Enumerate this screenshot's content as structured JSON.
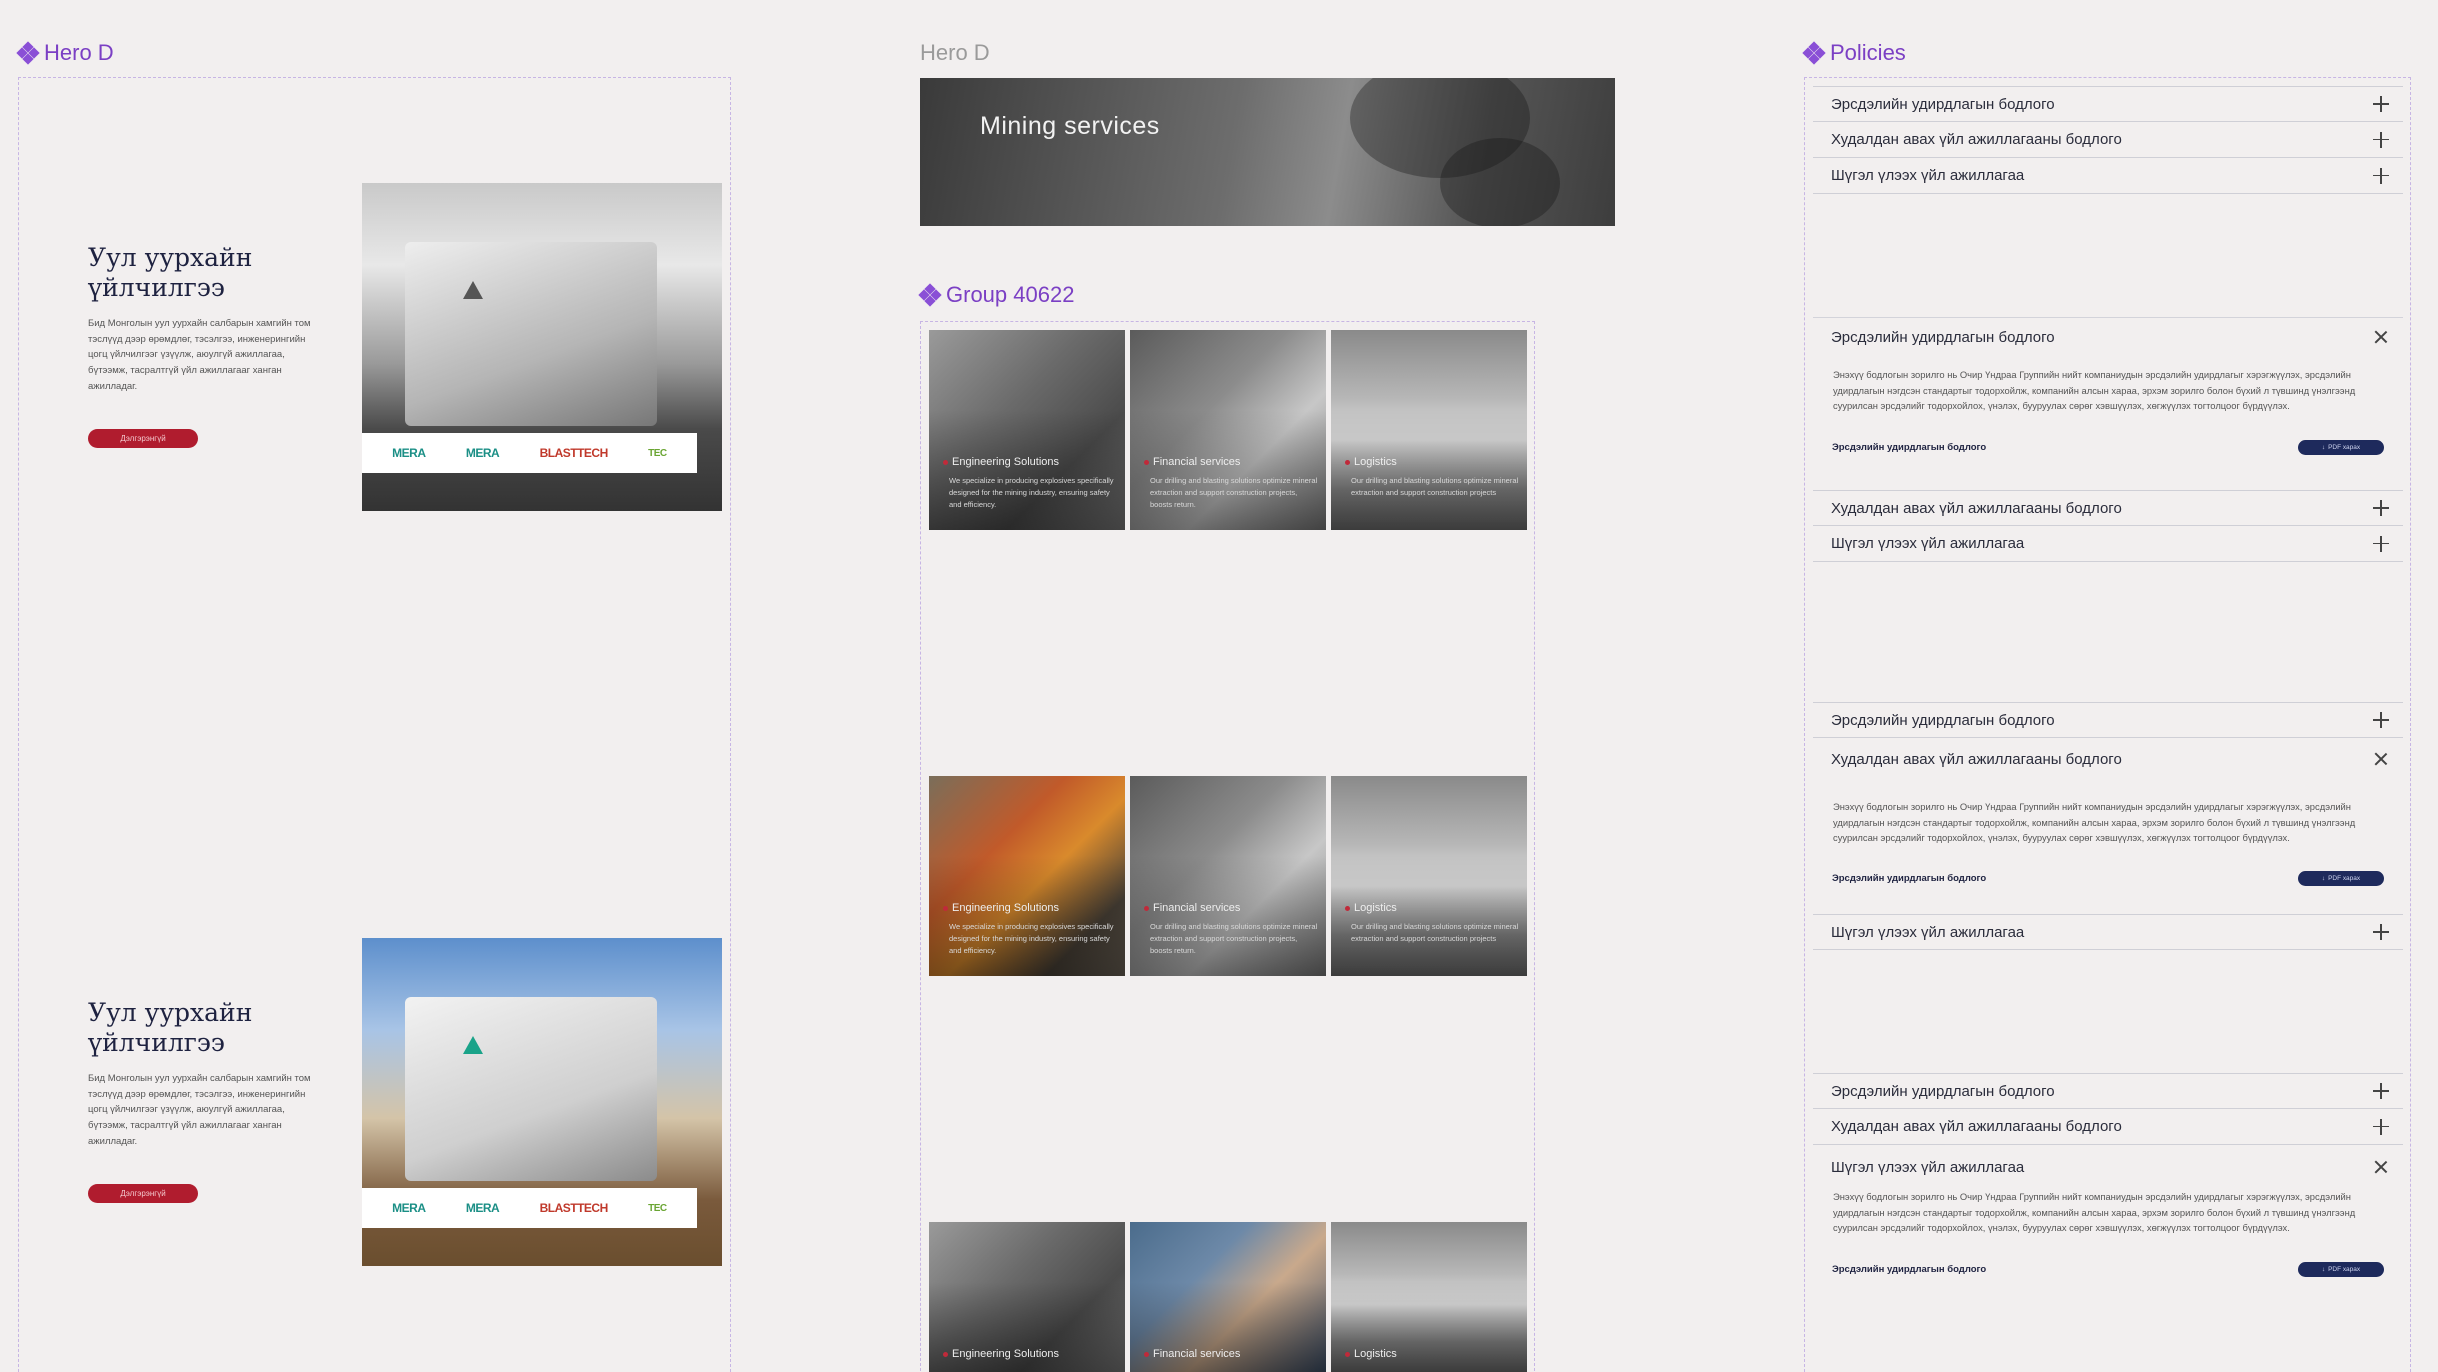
{
  "frames": {
    "hero_left_label": "Hero D",
    "hero_middle_label": "Hero D",
    "group_label": "Group 40622",
    "policies_label": "Policies"
  },
  "hero": {
    "title": "Уул уурхайн үйлчилгээ",
    "text": "Бид Монголын уул уурхайн салбарын хамгийн том тэслүүд дээр өрөмдлөг, тэсэлгээ, инженерингийн цогц үйлчилгээг үзүүлж, аюулгүй ажиллагаа, бүтээмж, тасралтгүй үйл ажиллагааг ханган ажилладаг.",
    "button": "Дэлгэрэнгүй",
    "logos": [
      "MERA",
      "MERA",
      "BLASTTECH",
      "TEC"
    ]
  },
  "banner": {
    "text": "Mining services"
  },
  "services": {
    "rows": [
      [
        {
          "title": "Engineering Solutions",
          "desc": "We specialize in producing explosives specifically designed for the mining industry, ensuring safety and efficiency."
        },
        {
          "title": "Financial services",
          "desc": "Our drilling and blasting solutions optimize mineral extraction and support construction projects, boosts return."
        },
        {
          "title": "Logistics",
          "desc": "Our drilling and blasting solutions optimize mineral extraction and support construction projects"
        }
      ],
      [
        {
          "title": "Engineering Solutions",
          "desc": "We specialize in producing explosives specifically designed for the mining industry, ensuring safety and efficiency."
        },
        {
          "title": "Financial services",
          "desc": "Our drilling and blasting solutions optimize mineral extraction and support construction projects, boosts return."
        },
        {
          "title": "Logistics",
          "desc": "Our drilling and blasting solutions optimize mineral extraction and support construction projects"
        }
      ],
      [
        {
          "title": "Engineering Solutions",
          "desc": ""
        },
        {
          "title": "Financial services",
          "desc": ""
        },
        {
          "title": "Logistics",
          "desc": ""
        }
      ]
    ]
  },
  "policies": {
    "items": [
      "Эрсдэлийн удирдлагын бодлого",
      "Худалдан авах үйл ажиллагааны бодлого",
      "Шүгэл үлээх үйл ажиллагаа"
    ],
    "body": "Энэхүү бодлогын зорилго нь Очир Үндраа Группийн нийт компаниудын эрсдэлийн удирдлагыг хэрэгжүүлэх, эрсдэлийн удирдлагын нэгдсэн стандартыг тодорхойлж, компанийн алсын хараа, эрхэм зорилго болон бүхий л түвшинд үнэлгээнд суурилсан эрсдэлийг тодорхойлох, үнэлэх, бууруулах сөрөг хэвшүүлэх, хөгжүүлэх тогтолцоог бүрдүүлэх.",
    "link": "Эрсдэлийн удирдлагын бодлого",
    "pdf": "PDF харах"
  },
  "colors": {
    "accent": "#7b3fc4",
    "brand_red": "#b01c2e",
    "navy": "#1e2a5c"
  }
}
